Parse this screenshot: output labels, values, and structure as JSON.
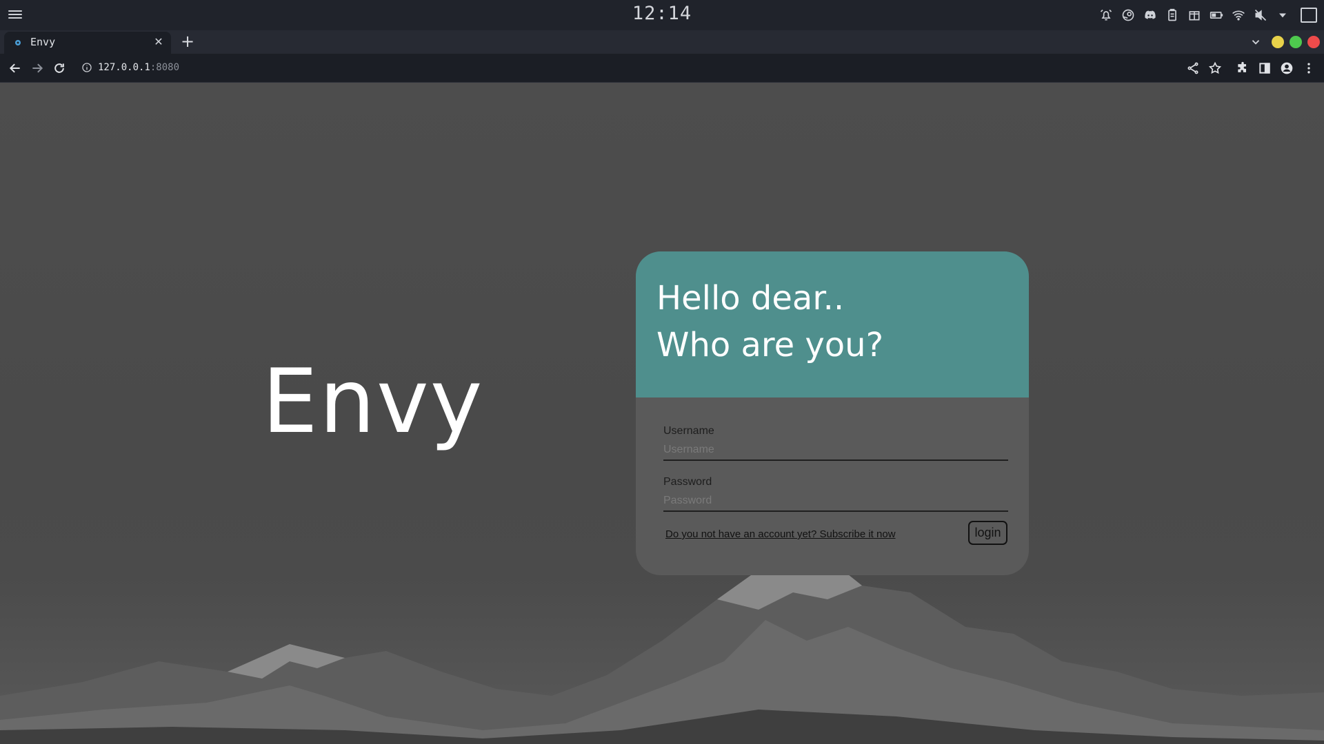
{
  "os": {
    "clock": "12:14",
    "tray_icons": [
      "alarm-icon",
      "steam-icon",
      "discord-icon",
      "clipboard-icon",
      "package-icon",
      "battery-icon",
      "wifi-icon",
      "volume-muted-icon",
      "dropdown-arrow-icon",
      "screen-icon"
    ]
  },
  "browser": {
    "tab": {
      "title": "Envy",
      "favicon": "gear-icon"
    },
    "url": {
      "host": "127.0.0.1",
      "port": ":8080"
    }
  },
  "page": {
    "brand": "Envy",
    "card": {
      "greeting_line1": "Hello dear..",
      "greeting_line2": "Who are you?",
      "username_label": "Username",
      "username_placeholder": "Username",
      "password_label": "Password",
      "password_placeholder": "Password",
      "subscribe_link": "Do you not have an account yet? Subscribe it now",
      "login_button": "login"
    }
  },
  "colors": {
    "card_header": "#4f8f8d",
    "card_body": "#5a5a5a",
    "page_background": "#4b4b4b"
  }
}
